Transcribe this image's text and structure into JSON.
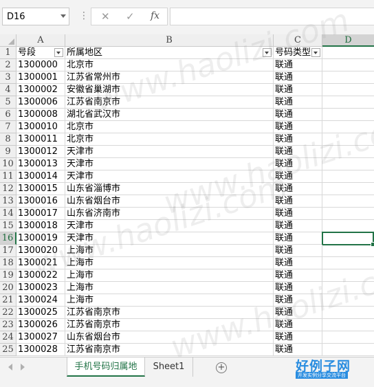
{
  "formula_bar": {
    "name_box": "D16",
    "fx_label": "fx",
    "cancel_glyph": "✕",
    "enter_glyph": "✓",
    "formula_value": ""
  },
  "columns": [
    "A",
    "B",
    "C",
    "D"
  ],
  "selected_column": "D",
  "selected_row": "16",
  "header_row": {
    "row_number": "1",
    "cells": [
      "号段",
      "所属地区",
      "号码类型"
    ]
  },
  "rows": [
    {
      "n": "2",
      "a": "1300000",
      "b": "北京市",
      "c": "联通"
    },
    {
      "n": "3",
      "a": "1300001",
      "b": "江苏省常州市",
      "c": "联通"
    },
    {
      "n": "4",
      "a": "1300002",
      "b": "安徽省巢湖市",
      "c": "联通"
    },
    {
      "n": "5",
      "a": "1300006",
      "b": "江苏省南京市",
      "c": "联通"
    },
    {
      "n": "6",
      "a": "1300008",
      "b": "湖北省武汉市",
      "c": "联通"
    },
    {
      "n": "7",
      "a": "1300010",
      "b": "北京市",
      "c": "联通"
    },
    {
      "n": "8",
      "a": "1300011",
      "b": "北京市",
      "c": "联通"
    },
    {
      "n": "9",
      "a": "1300012",
      "b": "天津市",
      "c": "联通"
    },
    {
      "n": "10",
      "a": "1300013",
      "b": "天津市",
      "c": "联通"
    },
    {
      "n": "11",
      "a": "1300014",
      "b": "天津市",
      "c": "联通"
    },
    {
      "n": "12",
      "a": "1300015",
      "b": "山东省淄博市",
      "c": "联通"
    },
    {
      "n": "13",
      "a": "1300016",
      "b": "山东省烟台市",
      "c": "联通"
    },
    {
      "n": "14",
      "a": "1300017",
      "b": "山东省济南市",
      "c": "联通"
    },
    {
      "n": "15",
      "a": "1300018",
      "b": "天津市",
      "c": "联通"
    },
    {
      "n": "16",
      "a": "1300019",
      "b": "天津市",
      "c": "联通"
    },
    {
      "n": "17",
      "a": "1300020",
      "b": "上海市",
      "c": "联通"
    },
    {
      "n": "18",
      "a": "1300021",
      "b": "上海市",
      "c": "联通"
    },
    {
      "n": "19",
      "a": "1300022",
      "b": "上海市",
      "c": "联通"
    },
    {
      "n": "20",
      "a": "1300023",
      "b": "上海市",
      "c": "联通"
    },
    {
      "n": "21",
      "a": "1300024",
      "b": "上海市",
      "c": "联通"
    },
    {
      "n": "22",
      "a": "1300025",
      "b": "江苏省南京市",
      "c": "联通"
    },
    {
      "n": "23",
      "a": "1300026",
      "b": "江苏省南京市",
      "c": "联通"
    },
    {
      "n": "24",
      "a": "1300027",
      "b": "山东省烟台市",
      "c": "联通"
    },
    {
      "n": "25",
      "a": "1300028",
      "b": "江苏省南京市",
      "c": "联通"
    }
  ],
  "sheet_tabs": [
    {
      "label": "手机号码归属地",
      "active": true
    },
    {
      "label": "Sheet1",
      "active": false
    }
  ],
  "add_sheet_glyph": "+",
  "watermark": "www.haolizi.com",
  "logo": {
    "title": "好例子网",
    "subtitle": "开发实例分享交流平台"
  },
  "colors": {
    "accent": "#217346",
    "logo_blue": "#2a8de0"
  }
}
